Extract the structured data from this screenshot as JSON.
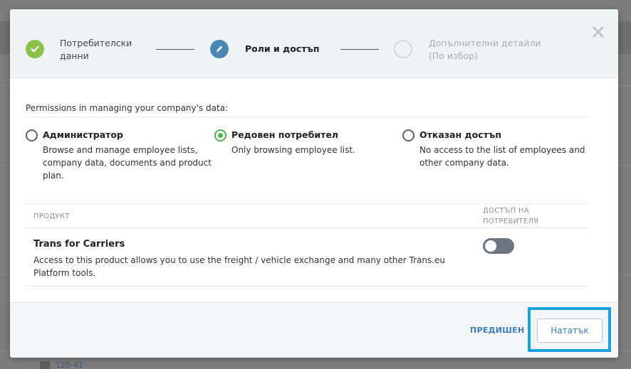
{
  "background": {
    "row_link": "120-41"
  },
  "wizard": {
    "steps": [
      {
        "label": "Потребителски данни",
        "state": "done"
      },
      {
        "label": "Роли и достъп",
        "state": "active"
      },
      {
        "label": "Допълнителни детайли (По избор)",
        "state": "todo"
      }
    ],
    "step1_line1": "Потребителски",
    "step1_line2": "данни",
    "step2_label": "Роли и достъп",
    "step3_line1": "Допълнителни детайли",
    "step3_line2": "(По избор)"
  },
  "permissions": {
    "title": "Permissions in managing your company's data:",
    "selected": "regular",
    "options": [
      {
        "title": "Администратор",
        "desc": "Browse and manage employee lists, company data, documents and product plan."
      },
      {
        "title": "Редовен потребител",
        "desc": "Only browsing employee list."
      },
      {
        "title": "Отказан достъп",
        "desc": "No access to the list of employees and other company data."
      }
    ]
  },
  "products": {
    "header_product": "ПРОДУКТ",
    "header_access": "ДОСТЪП НА ПОТРЕБИТЕЛЯ",
    "rows": [
      {
        "name": "Trans for Carriers",
        "desc": "Access to this product allows you to use the freight / vehicle exchange and many other Trans.eu Platform tools.",
        "enabled": false
      }
    ]
  },
  "footer": {
    "prev_label": "ПРЕДИШЕН",
    "next_label": "Нататък"
  },
  "colors": {
    "done": "#8bc34a",
    "active": "#4a87b4",
    "radio_on": "#4caf50",
    "highlight": "#1aa0db"
  }
}
